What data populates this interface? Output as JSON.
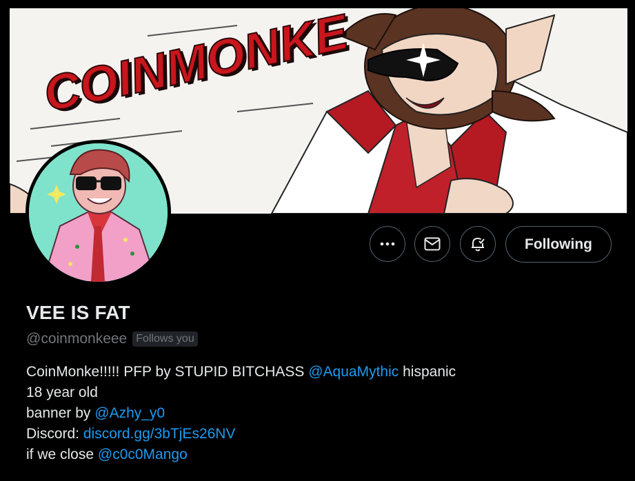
{
  "banner": {
    "logo_text": "COINMONKE"
  },
  "actions": {
    "more_label": "More",
    "message_label": "Message",
    "notify_label": "Notifications",
    "following_label": "Following"
  },
  "profile": {
    "display_name": "VEE IS FAT",
    "handle": "@coinmonkeee",
    "follows_you": "Follows you"
  },
  "bio": {
    "line1_text": "CoinMonke!!!!! PFP by STUPID BITCHASS ",
    "line1_link": "@AquaMythic",
    "line1_after": " hispanic",
    "line2_text": "18 year old",
    "line3_text": "banner by ",
    "line3_link": "@Azhy_y0",
    "line4_text": "Discord: ",
    "line4_link": "discord.gg/3bTjEs26NV",
    "line5_text": "if we close ",
    "line5_link": "@c0c0Mango"
  },
  "colors": {
    "background": "#000000",
    "text": "#e7e9ea",
    "muted": "#71767b",
    "link": "#1d9bf0",
    "border": "#536471",
    "logo_red": "#c8161d"
  }
}
